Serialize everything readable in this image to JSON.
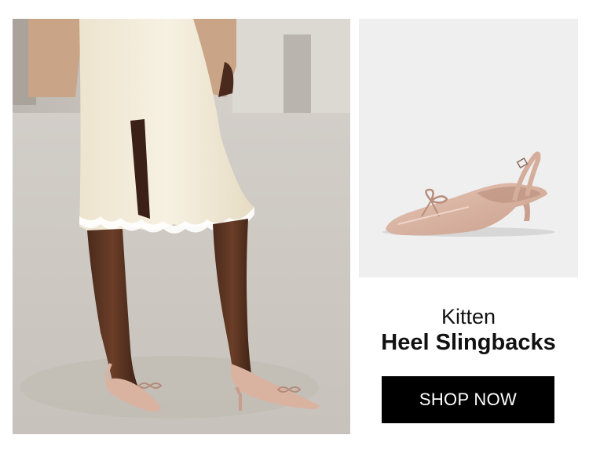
{
  "promo": {
    "subtitle": "Kitten",
    "title": "Heel Slingbacks",
    "cta_label": "SHOP NOW"
  },
  "colors": {
    "cta_background": "#000000",
    "cta_text": "#ffffff",
    "product_panel_background": "#efefef",
    "shoe_nude": "#d9b2a0"
  }
}
